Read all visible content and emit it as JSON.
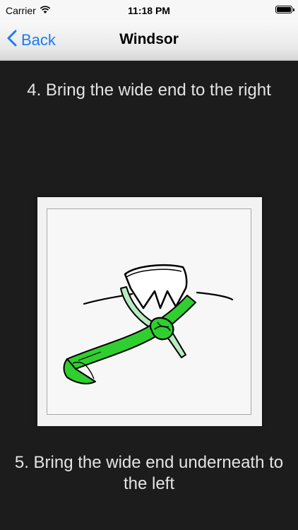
{
  "status_bar": {
    "carrier": "Carrier",
    "time": "11:18 PM",
    "icons": [
      "wifi-icon",
      "battery-icon"
    ]
  },
  "nav": {
    "back_label": "Back",
    "back_icon": "chevron-left-icon",
    "title": "Windsor"
  },
  "steps": {
    "current": "4. Bring the wide end to the right",
    "next": "5. Bring the wide end underneath to the left"
  },
  "illustration": {
    "subject": "tie-knot-step-illustration",
    "colors": {
      "tie_front": "#2fcf2f",
      "tie_back": "#b8ecc0",
      "outline": "#000000",
      "collar": "#ffffff"
    }
  },
  "colors": {
    "background": "#1c1c1c",
    "text": "#e4e4e4",
    "accent": "#1a7cf5"
  }
}
